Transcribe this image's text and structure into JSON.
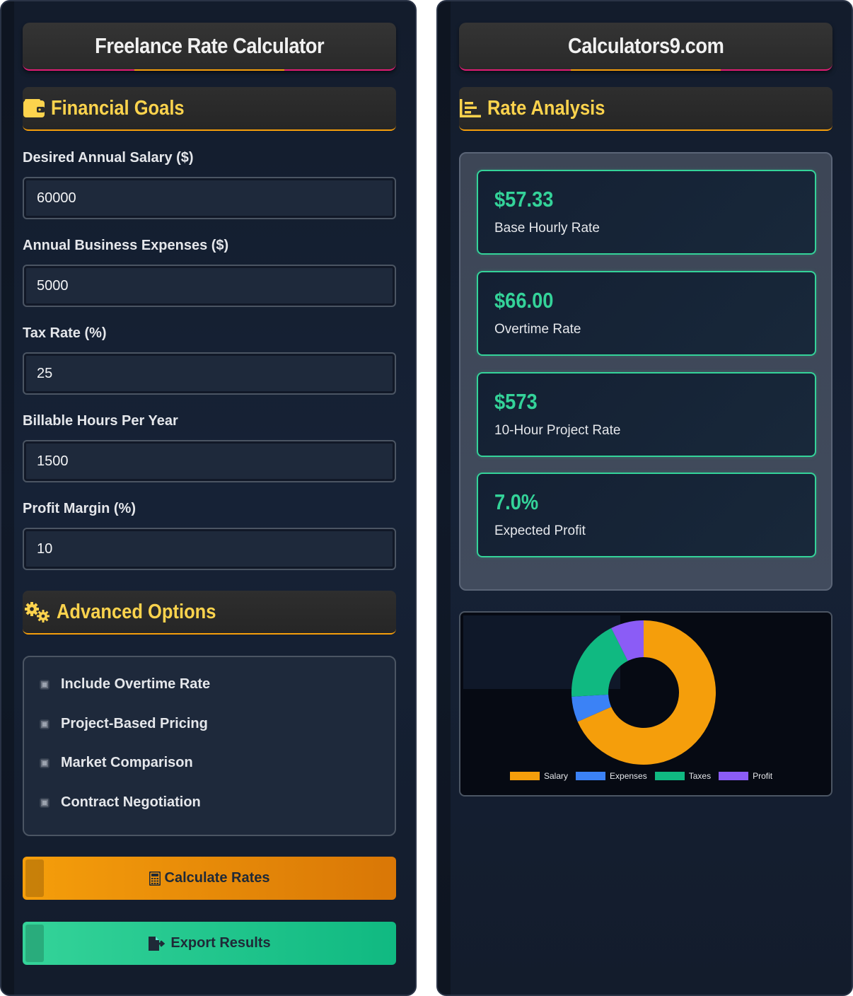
{
  "left": {
    "title": "Freelance Rate Calculator",
    "financial_goals": {
      "header": "Financial Goals",
      "icon": "wallet-icon",
      "fields": [
        {
          "label": "Desired Annual Salary ($)",
          "value": "60000"
        },
        {
          "label": "Annual Business Expenses ($)",
          "value": "5000"
        },
        {
          "label": "Tax Rate (%)",
          "value": "25"
        },
        {
          "label": "Billable Hours Per Year",
          "value": "1500"
        },
        {
          "label": "Profit Margin (%)",
          "value": "10"
        }
      ]
    },
    "advanced_options": {
      "header": "Advanced Options",
      "icon": "gears-icon",
      "options": [
        {
          "label": "Include Overtime Rate"
        },
        {
          "label": "Project-Based Pricing"
        },
        {
          "label": "Market Comparison"
        },
        {
          "label": "Contract Negotiation"
        }
      ]
    },
    "buttons": {
      "calculate": "Calculate Rates",
      "export": "Export Results"
    }
  },
  "right": {
    "title": "Calculators9.com",
    "rate_analysis": {
      "header": "Rate Analysis",
      "icon": "chart-bar-icon"
    },
    "results": [
      {
        "value": "$57.33",
        "label": "Base Hourly Rate"
      },
      {
        "value": "$66.00",
        "label": "Overtime Rate"
      },
      {
        "value": "$573",
        "label": "10-Hour Project Rate"
      },
      {
        "value": "7.0%",
        "label": "Expected Profit"
      }
    ]
  },
  "colors": {
    "accent_orange": "#f59e0b",
    "accent_green": "#34d399",
    "accent_pink": "#e11d74",
    "header_text": "#fcd34d"
  },
  "chart_data": {
    "type": "pie",
    "categories": [
      "Salary",
      "Expenses",
      "Taxes",
      "Profit"
    ],
    "values": [
      60000,
      5000,
      16250,
      6500
    ],
    "colors": [
      "#f59e0b",
      "#3b82f6",
      "#10b981",
      "#8b5cf6"
    ],
    "legend": "bottom"
  }
}
